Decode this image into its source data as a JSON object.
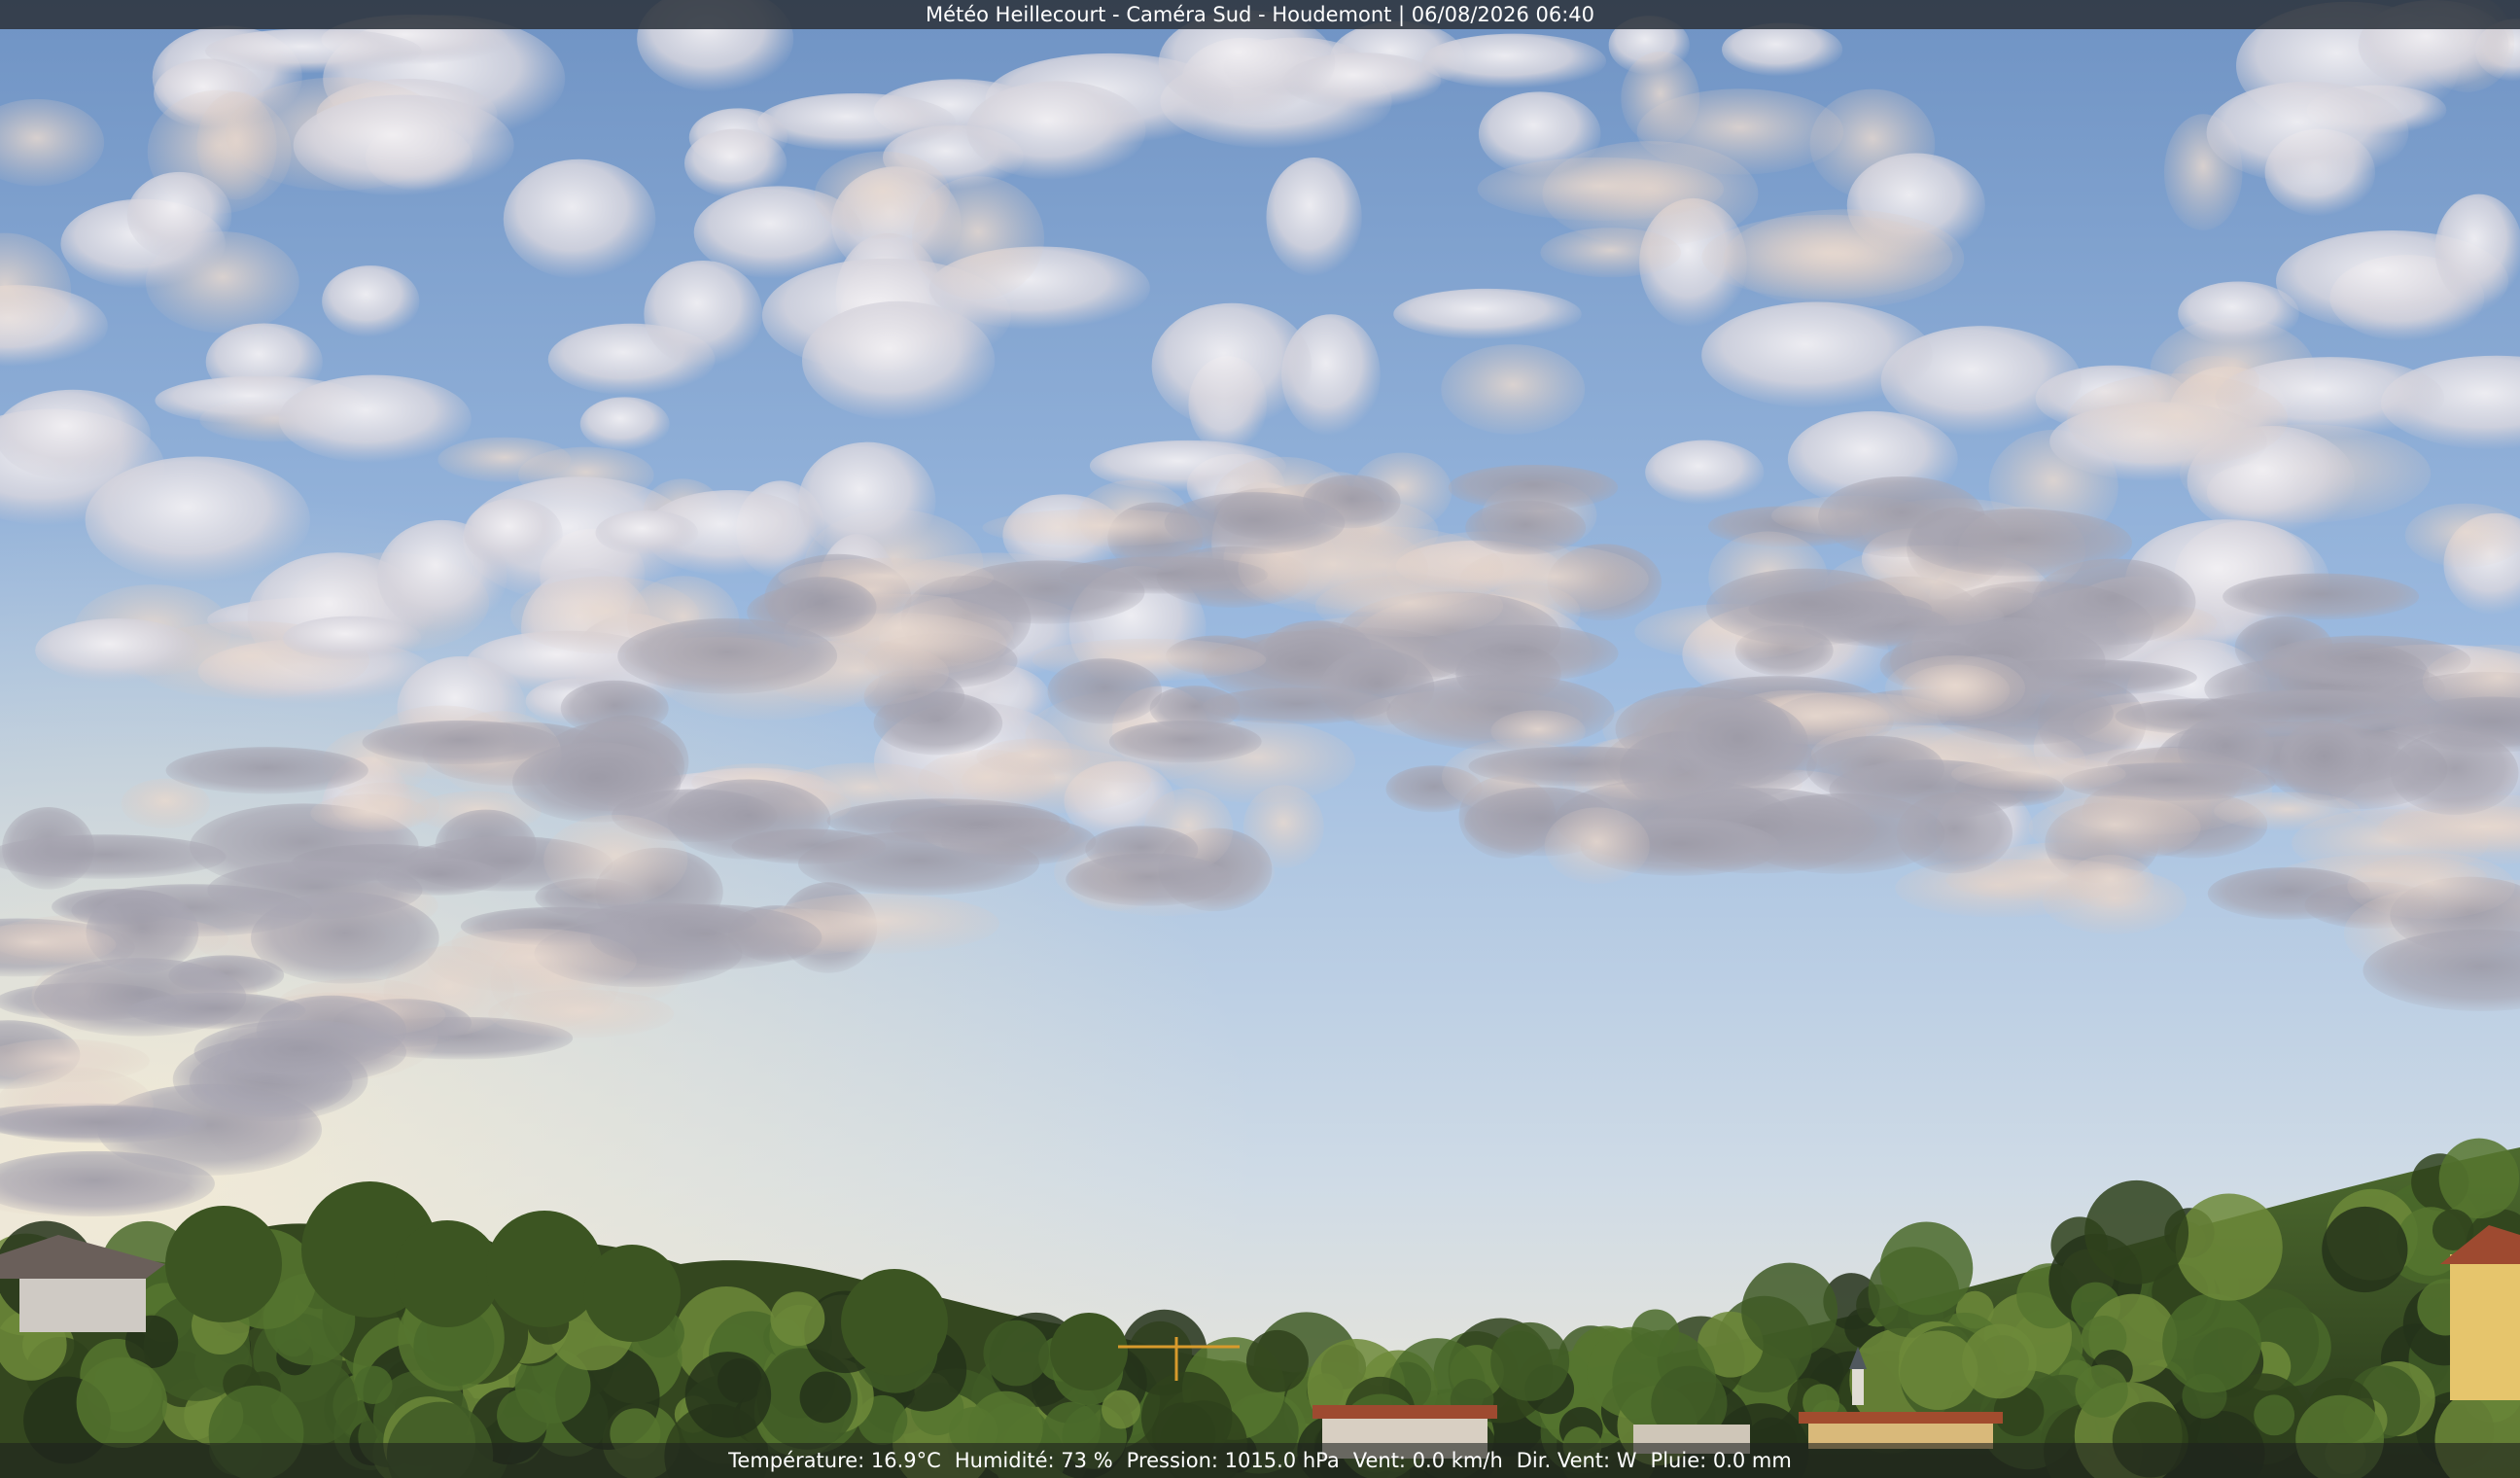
{
  "overlay": {
    "title": {
      "site": "Météo Heillecourt",
      "sep1": " - ",
      "camera": "Caméra Sud",
      "sep2": " - ",
      "location": "Houdemont",
      "sep3": " | ",
      "datetime": "06/08/2026 06:40"
    },
    "weather": {
      "temperature": "Température: 16.9°C",
      "humidity": "Humidité: 73 %",
      "pressure": "Pression: 1015.0 hPa",
      "wind_speed": "Vent: 0.0 km/h",
      "wind_dir": "Dir. Vent: W",
      "rain": "Pluie: 0.0 mm"
    }
  },
  "scene": {
    "description_colors": {
      "sky_top": "#6f93c4",
      "sky_mid": "#a4c0e0",
      "sky_horizon": "#eee7d6",
      "cloud_light": "#ecebef",
      "cloud_shadow": "#8f8f9f",
      "tree_dark": "#2a3a1e",
      "tree_light": "#5e7a34",
      "house_yellow": "#e6c56c",
      "roof_red": "#9e4a30"
    }
  }
}
